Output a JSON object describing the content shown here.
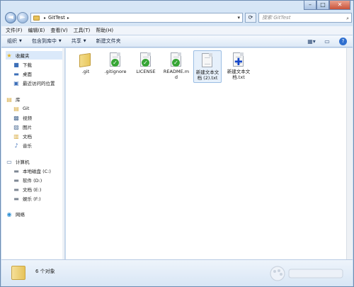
{
  "window": {
    "controls": {
      "minimize": "–",
      "maximize": "□",
      "close": "✕"
    }
  },
  "address": {
    "crumb": "GitTest",
    "search_placeholder": "搜索 GitTest"
  },
  "menubar": {
    "items": [
      "文件(F)",
      "编辑(E)",
      "查看(V)",
      "工具(T)",
      "帮助(H)"
    ]
  },
  "toolbar": {
    "organize": "组织",
    "include": "包含到库中",
    "share": "共享",
    "new_folder": "新建文件夹"
  },
  "navpane": {
    "favorites": "收藏夹",
    "favorites_items": [
      "下载",
      "桌面",
      "最近访问的位置"
    ],
    "libraries": "库",
    "library_items": [
      "Git",
      "视频",
      "图片",
      "文档",
      "音乐"
    ],
    "computer": "计算机",
    "drives": [
      "本地磁盘 (C:)",
      "软件 (D:)",
      "文档 (E:)",
      "娱乐 (F:)"
    ],
    "network": "网络"
  },
  "files": [
    {
      "name": ".git",
      "type": "folder",
      "overlay": "none"
    },
    {
      "name": ".gitignore",
      "type": "file",
      "overlay": "check"
    },
    {
      "name": "LICENSE",
      "type": "file",
      "overlay": "check"
    },
    {
      "name": "README.md",
      "type": "file",
      "overlay": "check"
    },
    {
      "name": "新建文本文档 (2).txt",
      "type": "file",
      "overlay": "none",
      "selected": true
    },
    {
      "name": "新建文本文档.txt",
      "type": "file",
      "overlay": "plus"
    }
  ],
  "status": {
    "count_text": "6 个对象"
  },
  "icons": {
    "back": "arrow-left-icon",
    "forward": "arrow-right-icon",
    "refresh": "refresh-icon",
    "search": "search-icon",
    "help": "help-icon",
    "views": "views-icon",
    "preview": "preview-pane-icon"
  }
}
